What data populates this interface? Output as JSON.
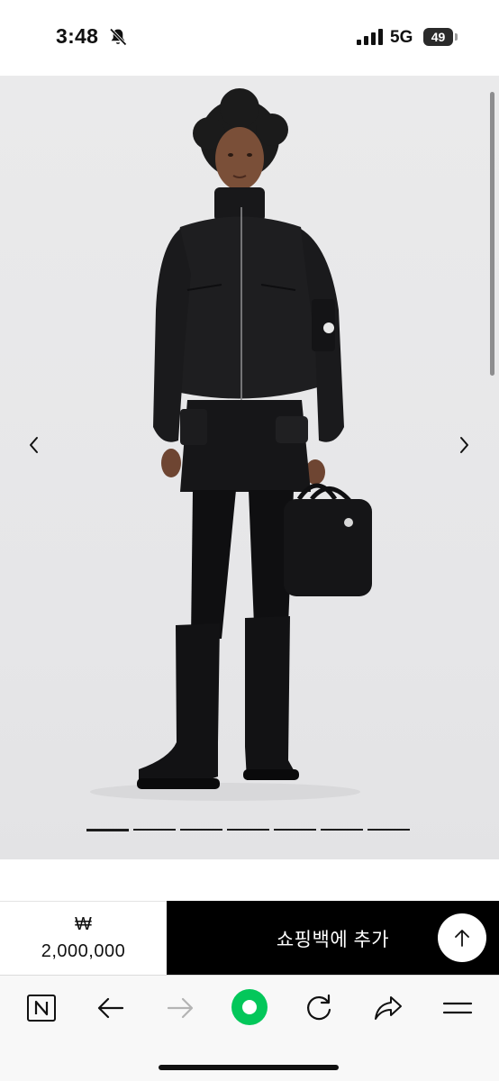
{
  "status_bar": {
    "time": "3:48",
    "network": "5G",
    "battery": "49",
    "icons": [
      "bell-slash-icon",
      "signal-bars-icon",
      "battery-icon"
    ]
  },
  "gallery": {
    "image_count": 7,
    "active_index": 0,
    "icons": [
      "chevron-left-icon",
      "chevron-right-icon"
    ]
  },
  "purchase": {
    "currency": "₩",
    "price": "2,000,000",
    "add_to_bag_label": "쇼핑백에 추가",
    "scroll_top_icon": "arrow-up-icon"
  },
  "browser_toolbar": {
    "items": [
      "naver-home-icon",
      "back-arrow-icon",
      "forward-arrow-icon",
      "green-dot-icon",
      "reload-icon",
      "share-icon",
      "menu-icon"
    ],
    "forward_disabled": true,
    "accent": "#03c75a"
  }
}
